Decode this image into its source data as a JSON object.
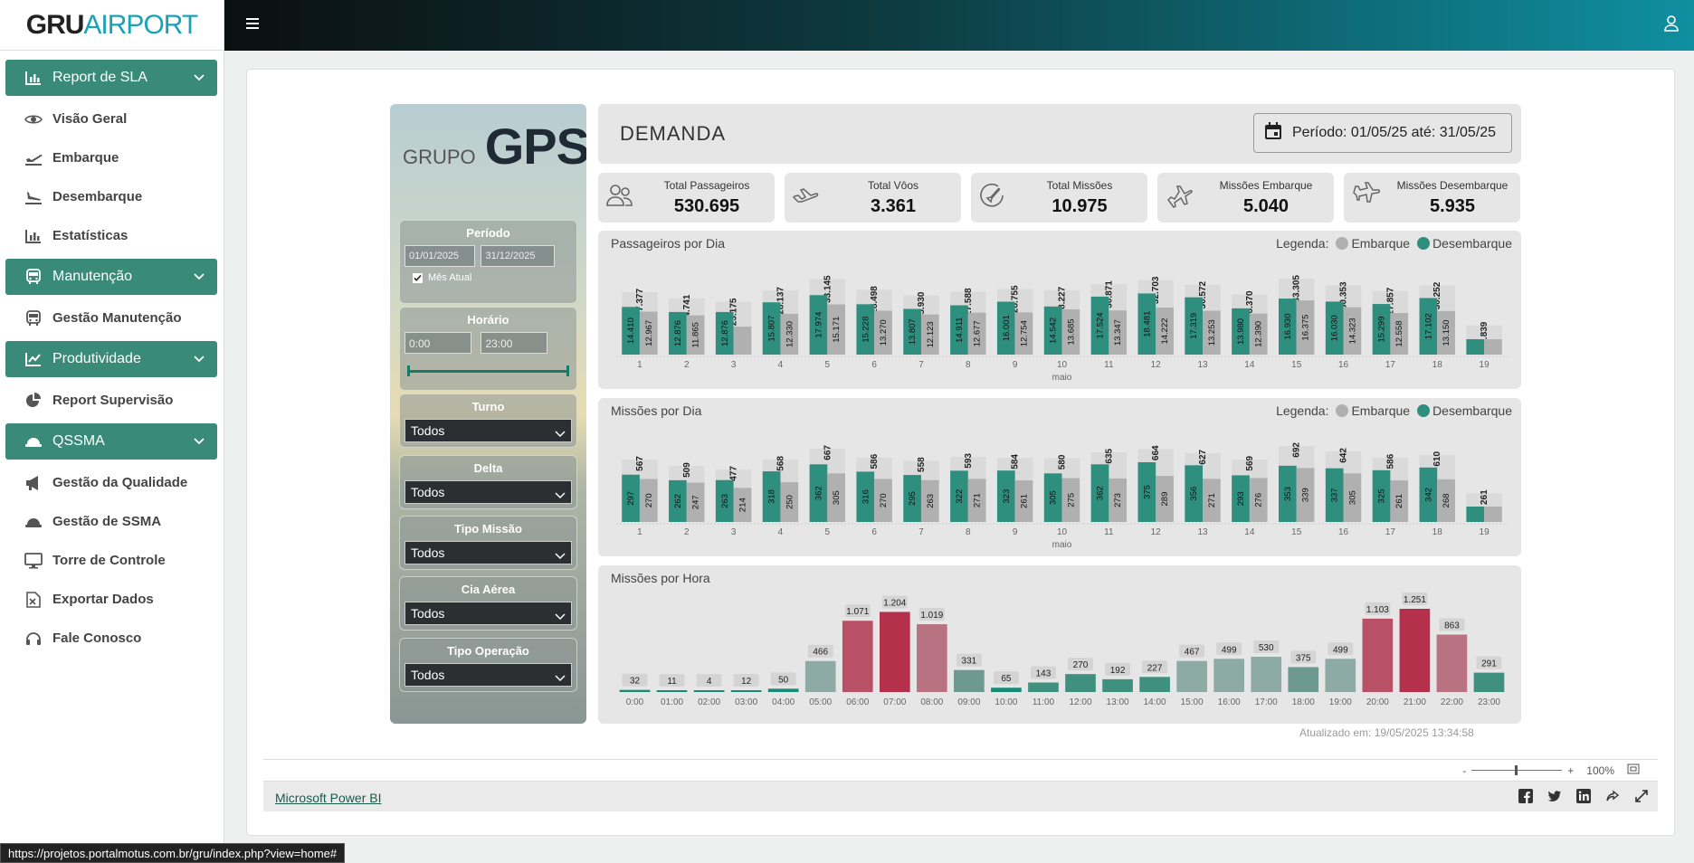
{
  "brand": {
    "logo_bold": "GRU",
    "logo_light": "AIRPORT"
  },
  "menu": [
    {
      "type": "group",
      "label": "Report de SLA",
      "icon": "bar-chart-icon"
    },
    {
      "type": "item",
      "label": "Visão Geral",
      "icon": "eye-icon"
    },
    {
      "type": "item",
      "label": "Embarque",
      "icon": "plane-departure-icon"
    },
    {
      "type": "item",
      "label": "Desembarque",
      "icon": "plane-arrival-icon"
    },
    {
      "type": "item",
      "label": "Estatísticas",
      "icon": "bar-chart-icon"
    },
    {
      "type": "group",
      "label": "Manutenção",
      "icon": "bus-icon"
    },
    {
      "type": "item",
      "label": "Gestão Manutenção",
      "icon": "bus-icon"
    },
    {
      "type": "group",
      "label": "Produtividade",
      "icon": "area-chart-icon"
    },
    {
      "type": "item",
      "label": "Report Supervisão",
      "icon": "pie-chart-icon"
    },
    {
      "type": "group",
      "label": "QSSMA",
      "icon": "hard-hat-icon"
    },
    {
      "type": "item",
      "label": "Gestão da Qualidade",
      "icon": "megaphone-icon"
    },
    {
      "type": "item",
      "label": "Gestão de SSMA",
      "icon": "hard-hat-icon"
    },
    {
      "type": "item",
      "label": "Torre de Controle",
      "icon": "monitor-icon"
    },
    {
      "type": "item",
      "label": "Exportar Dados",
      "icon": "excel-file-icon"
    },
    {
      "type": "item",
      "label": "Fale Conosco",
      "icon": "headset-icon"
    }
  ],
  "filters": {
    "brand_small": "GRUPO",
    "brand_big": "GPS",
    "periodo_title": "Período",
    "date_from": "01/01/2025",
    "date_to": "31/12/2025",
    "mes_atual": "Mês Atual",
    "mes_atual_checked": true,
    "horario_title": "Horário",
    "time_from": "0:00",
    "time_to": "23:00",
    "turno_title": "Turno",
    "turno_value": "Todos",
    "delta_title": "Delta",
    "delta_value": "Todos",
    "tipo_missao_title": "Tipo Missão",
    "tipo_missao_value": "Todos",
    "cia_title": "Cia Aérea",
    "cia_value": "Todos",
    "tipo_op_title": "Tipo Operação",
    "tipo_op_value": "Todos"
  },
  "dashboard": {
    "title": "DEMANDA",
    "period": "Período: 01/05/25 até: 31/05/25",
    "updated": "Atualizado em: 19/05/2025 13:34:58"
  },
  "kpis": [
    {
      "label": "Total Passageiros",
      "value": "530.695",
      "icon": "people-icon"
    },
    {
      "label": "Total Vôos",
      "value": "3.361",
      "icon": "airplane-icon"
    },
    {
      "label": "Total Missões",
      "value": "10.975",
      "icon": "mission-icon"
    },
    {
      "label": "Missões Embarque",
      "value": "5.040",
      "icon": "plane-departure-icon"
    },
    {
      "label": "Missões Desembarque",
      "value": "5.935",
      "icon": "plane-arrival-icon"
    }
  ],
  "legend": {
    "prefix": "Legenda:",
    "embarque": "Embarque",
    "desembarque": "Desembarque"
  },
  "colors": {
    "embarque": "#b0b0b0",
    "desembarque": "#2f8f7f",
    "hour_low": "#1a8a78",
    "hour_mid": "#8fb0a8",
    "hour_high": "#c0445a"
  },
  "chart_data": [
    {
      "type": "bar",
      "title": "Passageiros por Dia",
      "xlabel": "maio",
      "categories": [
        "1",
        "2",
        "3",
        "4",
        "5",
        "6",
        "7",
        "8",
        "9",
        "10",
        "11",
        "12",
        "13",
        "14",
        "15",
        "16",
        "17",
        "18",
        "19"
      ],
      "totals": [
        27377,
        24741,
        23175,
        28137,
        33145,
        28498,
        25930,
        27588,
        28755,
        28227,
        30871,
        32703,
        30572,
        26370,
        33305,
        30353,
        27857,
        30252,
        12839
      ],
      "totals_labels": [
        "27.377",
        "24.741",
        "23.175",
        "28.137",
        "33.145",
        "28.498",
        "25.930",
        "27.588",
        "28.755",
        "28.227",
        "30.871",
        "32.703",
        "30.572",
        "26.370",
        "33.305",
        "30.353",
        "27.857",
        "30.252",
        "12.839"
      ],
      "series": [
        {
          "name": "Desembarque",
          "values": [
            14410,
            12876,
            12876,
            15807,
            17974,
            15228,
            13807,
            14911,
            16001,
            14542,
            17524,
            18481,
            17319,
            13980,
            16930,
            16030,
            15299,
            17102,
            null
          ],
          "labels": [
            "14.410",
            "12.876",
            "12.876",
            "15.807",
            "17.974",
            "15.228",
            "13.807",
            "14.911",
            "16.001",
            "14.542",
            "17.524",
            "18.481",
            "17.319",
            "13.980",
            "16.930",
            "16.030",
            "15.299",
            "17.102",
            ""
          ]
        },
        {
          "name": "Embarque",
          "values": [
            12967,
            11865,
            null,
            12330,
            15171,
            13270,
            12123,
            12677,
            12754,
            13685,
            13347,
            14222,
            13253,
            12390,
            16375,
            14323,
            12558,
            13150,
            null
          ],
          "labels": [
            "12.967",
            "11.865",
            "",
            "12.330",
            "15.171",
            "13.270",
            "12.123",
            "12.677",
            "12.754",
            "13.685",
            "13.347",
            "14.222",
            "13.253",
            "12.390",
            "16.375",
            "14.323",
            "12.558",
            "13.150",
            ""
          ]
        }
      ]
    },
    {
      "type": "bar",
      "title": "Missões por Dia",
      "xlabel": "maio",
      "categories": [
        "1",
        "2",
        "3",
        "4",
        "5",
        "6",
        "7",
        "8",
        "9",
        "10",
        "11",
        "12",
        "13",
        "14",
        "15",
        "16",
        "17",
        "18",
        "19"
      ],
      "totals": [
        567,
        509,
        477,
        568,
        667,
        586,
        558,
        593,
        584,
        580,
        635,
        664,
        627,
        569,
        692,
        642,
        586,
        610,
        261
      ],
      "totals_labels": [
        "567",
        "509",
        "477",
        "568",
        "667",
        "586",
        "558",
        "593",
        "584",
        "580",
        "635",
        "664",
        "627",
        "569",
        "692",
        "642",
        "586",
        "610",
        "261"
      ],
      "series": [
        {
          "name": "Desembarque",
          "values": [
            297,
            262,
            263,
            318,
            362,
            316,
            295,
            322,
            323,
            305,
            362,
            375,
            356,
            293,
            353,
            337,
            325,
            342,
            null
          ],
          "labels": [
            "297",
            "262",
            "263",
            "318",
            "362",
            "316",
            "295",
            "322",
            "323",
            "305",
            "362",
            "375",
            "356",
            "293",
            "353",
            "337",
            "325",
            "342",
            ""
          ]
        },
        {
          "name": "Embarque",
          "values": [
            270,
            247,
            214,
            250,
            305,
            270,
            263,
            271,
            261,
            275,
            273,
            289,
            271,
            276,
            339,
            305,
            261,
            268,
            null
          ],
          "labels": [
            "270",
            "247",
            "214",
            "250",
            "305",
            "270",
            "263",
            "271",
            "261",
            "275",
            "273",
            "289",
            "271",
            "276",
            "339",
            "305",
            "261",
            "268",
            ""
          ]
        }
      ]
    },
    {
      "type": "bar",
      "title": "Missões por Hora",
      "categories": [
        "0:00",
        "01:00",
        "02:00",
        "03:00",
        "04:00",
        "05:00",
        "06:00",
        "07:00",
        "08:00",
        "09:00",
        "10:00",
        "11:00",
        "12:00",
        "13:00",
        "14:00",
        "15:00",
        "16:00",
        "17:00",
        "18:00",
        "19:00",
        "20:00",
        "21:00",
        "22:00",
        "23:00"
      ],
      "values": [
        32,
        11,
        4,
        12,
        50,
        466,
        1071,
        1204,
        1019,
        331,
        65,
        143,
        270,
        192,
        227,
        467,
        499,
        530,
        375,
        499,
        1103,
        1251,
        863,
        291
      ],
      "labels": [
        "32",
        "11",
        "4",
        "12",
        "50",
        "466",
        "1.071",
        "1.204",
        "1.019",
        "331",
        "65",
        "143",
        "270",
        "192",
        "227",
        "467",
        "499",
        "530",
        "375",
        "499",
        "1.103",
        "1.251",
        "863",
        "291"
      ]
    }
  ],
  "powerbi": {
    "link": "Microsoft Power BI",
    "zoom": "100%",
    "zoom_minus": "-",
    "zoom_plus": "+"
  },
  "status_url": "https://projetos.portalmotus.com.br/gru/index.php?view=home#"
}
